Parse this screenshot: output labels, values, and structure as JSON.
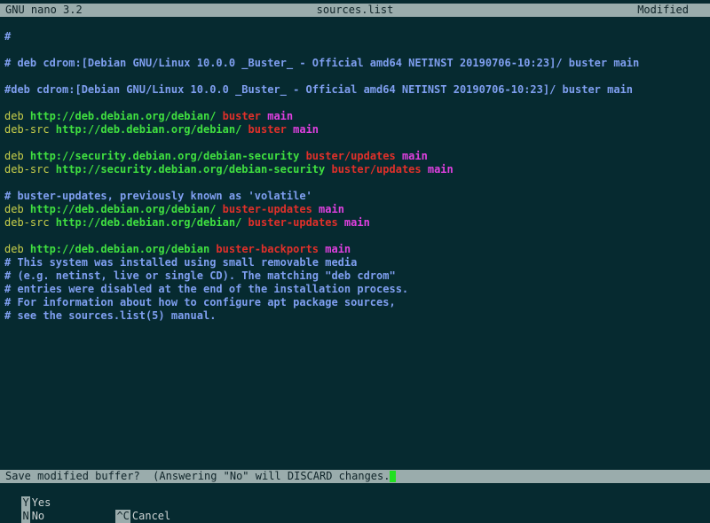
{
  "titlebar": {
    "app": "GNU nano 3.2",
    "filename": "sources.list",
    "status": "Modified"
  },
  "editor": {
    "lines": [
      {
        "segments": [
          {
            "t": "#",
            "c": "c-comment"
          }
        ]
      },
      {
        "segments": []
      },
      {
        "segments": [
          {
            "t": "# deb cdrom:[Debian GNU/Linux 10.0.0 _Buster_ - Official amd64 NETINST 20190706-10:23]/ buster main",
            "c": "c-comment"
          }
        ]
      },
      {
        "segments": []
      },
      {
        "segments": [
          {
            "t": "#deb cdrom:[Debian GNU/Linux 10.0.0 _Buster_ - Official amd64 NETINST 20190706-10:23]/ buster main",
            "c": "c-comment"
          }
        ]
      },
      {
        "segments": []
      },
      {
        "segments": [
          {
            "t": "deb ",
            "c": "c-key"
          },
          {
            "t": "http://deb.debian.org/debian/ ",
            "c": "c-url"
          },
          {
            "t": "buster ",
            "c": "c-suite"
          },
          {
            "t": "main",
            "c": "c-comp"
          }
        ]
      },
      {
        "segments": [
          {
            "t": "deb-src ",
            "c": "c-key"
          },
          {
            "t": "http://deb.debian.org/debian/ ",
            "c": "c-url"
          },
          {
            "t": "buster ",
            "c": "c-suite"
          },
          {
            "t": "main",
            "c": "c-comp"
          }
        ]
      },
      {
        "segments": []
      },
      {
        "segments": [
          {
            "t": "deb ",
            "c": "c-key"
          },
          {
            "t": "http://security.debian.org/debian-security ",
            "c": "c-url"
          },
          {
            "t": "buster/updates ",
            "c": "c-suite"
          },
          {
            "t": "main",
            "c": "c-comp"
          }
        ]
      },
      {
        "segments": [
          {
            "t": "deb-src ",
            "c": "c-key"
          },
          {
            "t": "http://security.debian.org/debian-security ",
            "c": "c-url"
          },
          {
            "t": "buster/updates ",
            "c": "c-suite"
          },
          {
            "t": "main",
            "c": "c-comp"
          }
        ]
      },
      {
        "segments": []
      },
      {
        "segments": [
          {
            "t": "# buster-updates, previously known as 'volatile'",
            "c": "c-comment"
          }
        ]
      },
      {
        "segments": [
          {
            "t": "deb ",
            "c": "c-key"
          },
          {
            "t": "http://deb.debian.org/debian/ ",
            "c": "c-url"
          },
          {
            "t": "buster-updates ",
            "c": "c-suite"
          },
          {
            "t": "main",
            "c": "c-comp"
          }
        ]
      },
      {
        "segments": [
          {
            "t": "deb-src ",
            "c": "c-key"
          },
          {
            "t": "http://deb.debian.org/debian/ ",
            "c": "c-url"
          },
          {
            "t": "buster-updates ",
            "c": "c-suite"
          },
          {
            "t": "main",
            "c": "c-comp"
          }
        ]
      },
      {
        "segments": []
      },
      {
        "segments": [
          {
            "t": "deb ",
            "c": "c-key"
          },
          {
            "t": "http://deb.debian.org/debian ",
            "c": "c-url"
          },
          {
            "t": "buster-backports ",
            "c": "c-suite"
          },
          {
            "t": "main",
            "c": "c-comp"
          }
        ]
      },
      {
        "segments": [
          {
            "t": "# This system was installed using small removable media",
            "c": "c-comment"
          }
        ]
      },
      {
        "segments": [
          {
            "t": "# (e.g. netinst, live or single CD). The matching \"deb cdrom\"",
            "c": "c-comment"
          }
        ]
      },
      {
        "segments": [
          {
            "t": "# entries were disabled at the end of the installation process.",
            "c": "c-comment"
          }
        ]
      },
      {
        "segments": [
          {
            "t": "# For information about how to configure apt package sources,",
            "c": "c-comment"
          }
        ]
      },
      {
        "segments": [
          {
            "t": "# see the sources.list(5) manual.",
            "c": "c-comment"
          }
        ]
      }
    ]
  },
  "prompt": {
    "text": "Save modified buffer?  (Answering \"No\" will DISCARD changes.) "
  },
  "options": {
    "yes": {
      "key": "Y",
      "label": "Yes"
    },
    "no": {
      "key": "N",
      "label": "No"
    },
    "cancel": {
      "key": "^C",
      "label": "Cancel"
    }
  },
  "colors": {
    "background": "#062a30",
    "bar": "#9aacac",
    "comment": "#7f9ff0",
    "url": "#40e040",
    "suite": "#e0302a",
    "component": "#e040e0",
    "keyword": "#c9d04a",
    "cursor": "#22e022"
  }
}
